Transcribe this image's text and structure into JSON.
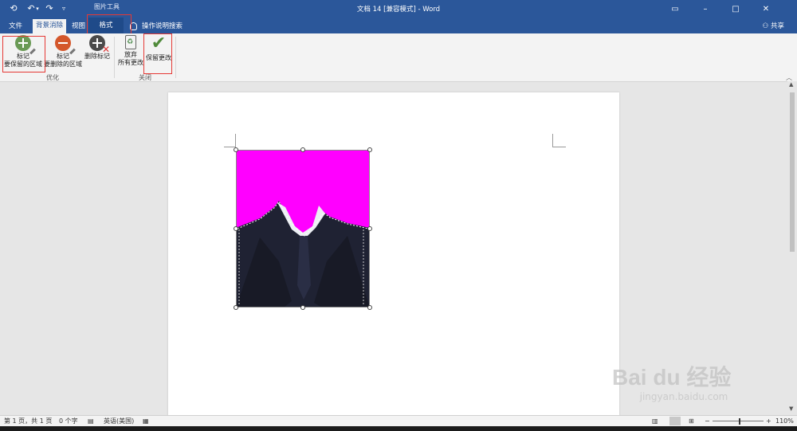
{
  "title_bar": {
    "context_tools_label": "图片工具",
    "document_title": "文档 14 [兼容模式]  -  Word"
  },
  "tabs": [
    {
      "label": "文件"
    },
    {
      "label": "背景消除"
    },
    {
      "label": "视图"
    },
    {
      "label": "格式"
    }
  ],
  "tell_me": "操作说明搜索",
  "share": "共享",
  "ribbon": {
    "mark_keep": {
      "line1": "标记",
      "line2": "要保留的区域"
    },
    "mark_remove": {
      "line1": "标记",
      "line2": "要删除的区域"
    },
    "delete_mark": {
      "label": "删除标记"
    },
    "discard": {
      "line1": "放弃",
      "line2": "所有更改"
    },
    "keep_changes": {
      "label": "保留更改"
    },
    "group_refine": "优化",
    "group_close": "关闭"
  },
  "status_bar": {
    "page": "第 1 页，共 1 页",
    "words": "0 个字",
    "language": "英语(美国)",
    "zoom": "110%",
    "zoom_level_percent": 110
  },
  "watermark": {
    "brand": "Bai du 经验",
    "url": "jingyan.baidu.com"
  },
  "colors": {
    "title_bar": "#2b579a",
    "ribbon": "#f3f3f3",
    "background_removal_overlay": "#ff00ff",
    "highlight_box": "#e53935",
    "keep_check": "#4f8a3a"
  }
}
